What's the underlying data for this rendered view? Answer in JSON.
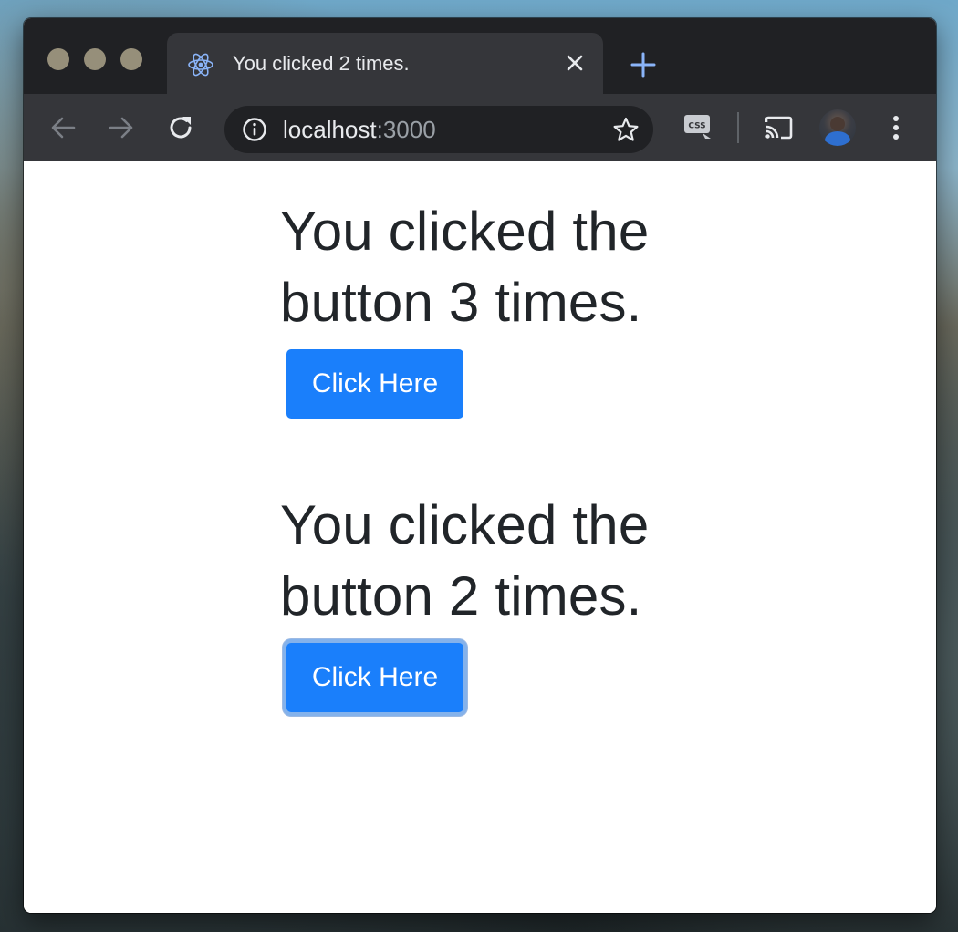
{
  "browser": {
    "tab": {
      "title": "You clicked 2 times.",
      "favicon": "react-logo-icon",
      "close_icon": "close-icon"
    },
    "new_tab_icon": "plus-icon",
    "toolbar": {
      "back_icon": "back-arrow-icon",
      "forward_icon": "forward-arrow-icon",
      "reload_icon": "reload-icon",
      "site_info_icon": "info-icon",
      "url_host": "localhost",
      "url_port": ":3000",
      "bookmark_icon": "star-icon",
      "extension_icon": "css-extension-icon",
      "cast_icon": "cast-icon",
      "profile": "avatar",
      "menu_icon": "more-vertical-icon"
    },
    "colors": {
      "tabstrip": "#202124",
      "toolbar": "#35363a",
      "omnibox": "#202124"
    }
  },
  "page": {
    "counters": [
      {
        "heading_line1": "You clicked the",
        "heading_line2": "button 3 times.",
        "button_label": "Click Here",
        "focused": false
      },
      {
        "heading_line1": "You clicked the",
        "heading_line2": "button 2 times.",
        "button_label": "Click Here",
        "focused": true
      }
    ],
    "colors": {
      "text": "#212529",
      "button": "#1a7ffb"
    }
  }
}
